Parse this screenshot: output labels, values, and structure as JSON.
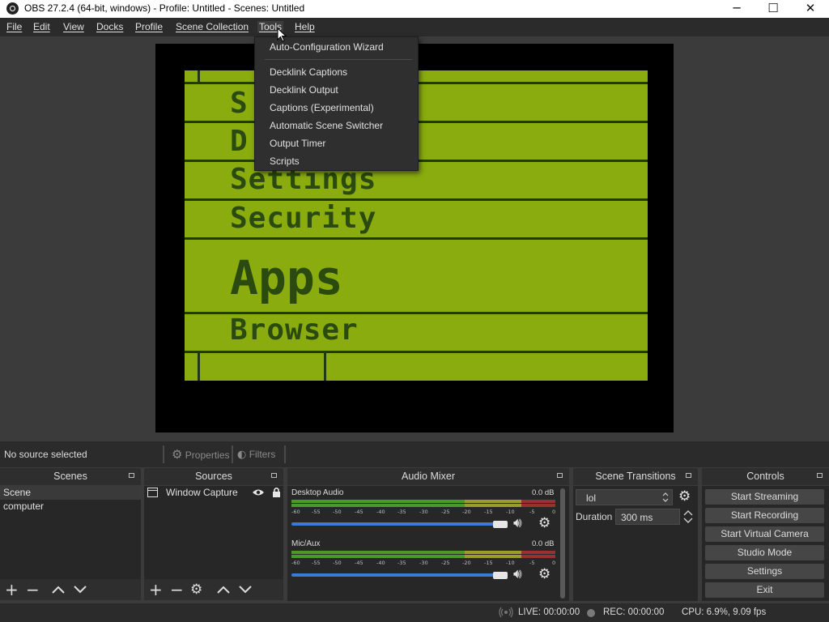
{
  "window": {
    "title": "OBS 27.2.4 (64-bit, windows) - Profile: Untitled - Scenes: Untitled",
    "minimize": "─",
    "maximize": "☐",
    "close": "✕"
  },
  "menubar": {
    "items": [
      "File",
      "Edit",
      "View",
      "Docks",
      "Profile",
      "Scene Collection",
      "Tools",
      "Help"
    ],
    "open_menu": "Tools"
  },
  "tools_menu": {
    "items": [
      "Auto-Configuration Wizard",
      "Decklink Captions",
      "Decklink Output",
      "Captions (Experimental)",
      "Automatic Scene Switcher",
      "Output Timer",
      "Scripts"
    ]
  },
  "preview": {
    "lcd_items": [
      "Settings",
      "Security",
      "Apps",
      "Browser"
    ],
    "lcd_partial": [
      "S",
      "D"
    ],
    "colors": {
      "lcd_bg": "#8bac0f",
      "lcd_ink": "#1f3a0f"
    }
  },
  "source_toolbar": {
    "status": "No source selected",
    "properties": "Properties",
    "filters": "Filters"
  },
  "docks": {
    "scenes": {
      "title": "Scenes",
      "items": [
        "Scene",
        "computer"
      ]
    },
    "sources": {
      "title": "Sources",
      "items": [
        {
          "name": "Window Capture"
        }
      ]
    },
    "mixer": {
      "title": "Audio Mixer",
      "channels": [
        {
          "name": "Desktop Audio",
          "db": "0.0 dB"
        },
        {
          "name": "Mic/Aux",
          "db": "0.0 dB"
        }
      ],
      "ticks": [
        "-60",
        "-55",
        "-50",
        "-45",
        "-40",
        "-35",
        "-30",
        "-25",
        "-20",
        "-15",
        "-10",
        "-5",
        "0"
      ]
    },
    "transitions": {
      "title": "Scene Transitions",
      "selected": "lol",
      "duration_label": "Duration",
      "duration_value": "300 ms"
    },
    "controls": {
      "title": "Controls",
      "buttons": [
        "Start Streaming",
        "Start Recording",
        "Start Virtual Camera",
        "Studio Mode",
        "Settings",
        "Exit"
      ]
    }
  },
  "statusbar": {
    "live": "LIVE: 00:00:00",
    "rec": "REC: 00:00:00",
    "cpu": "CPU: 6.9%, 9.09 fps"
  }
}
